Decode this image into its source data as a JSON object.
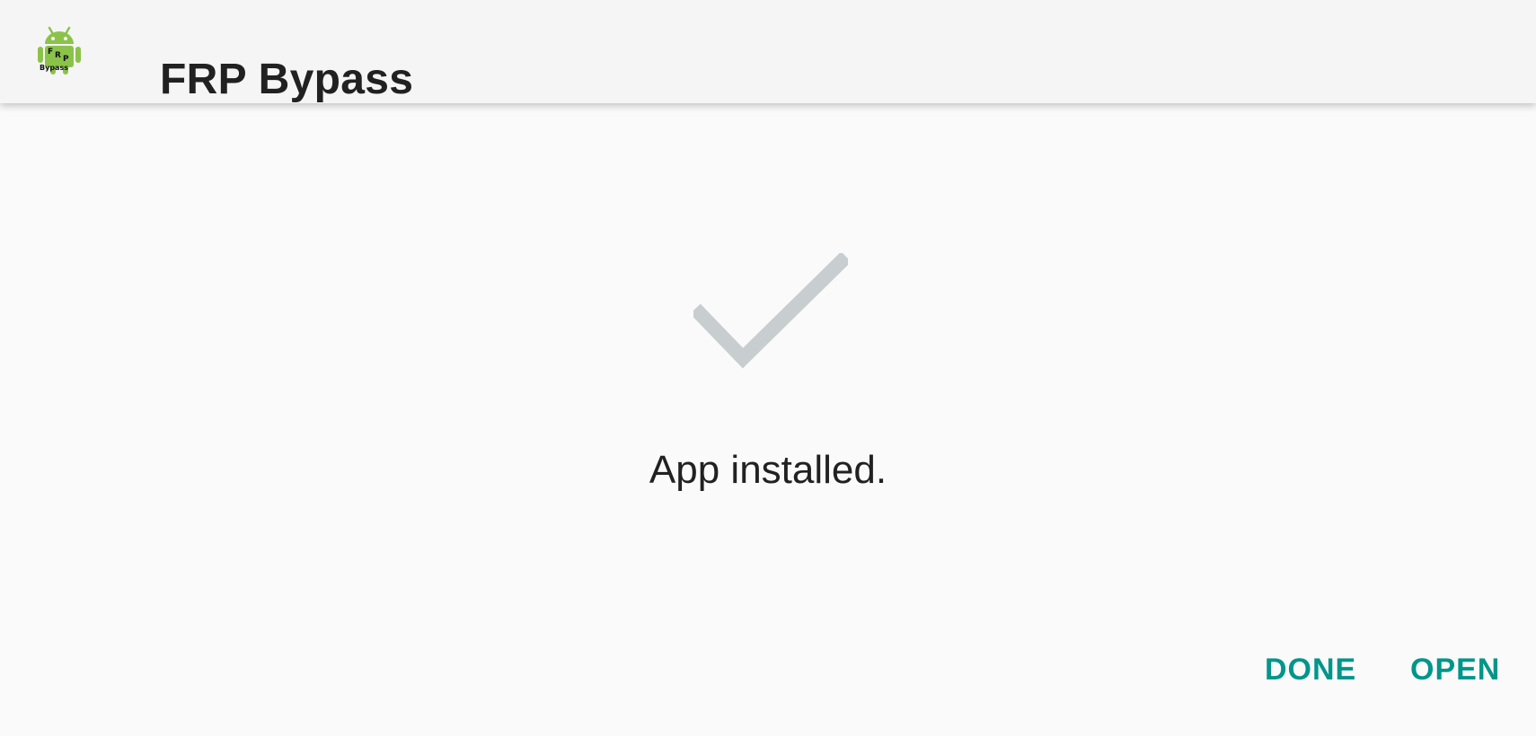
{
  "app_bar": {
    "icon": "frp-bypass-android-logo-icon",
    "icon_logo_text": "FRP Bypass",
    "title": "FRP Bypass"
  },
  "main": {
    "status_icon": "checkmark-icon",
    "status_text": "App installed."
  },
  "actions": {
    "done_label": "DONE",
    "open_label": "OPEN"
  },
  "colors": {
    "accent": "#00968a",
    "check": "#c8cdd0",
    "android_green": "#8bc34a",
    "text": "#212121",
    "app_bar_bg": "#f5f5f5",
    "page_bg": "#fafafa"
  }
}
